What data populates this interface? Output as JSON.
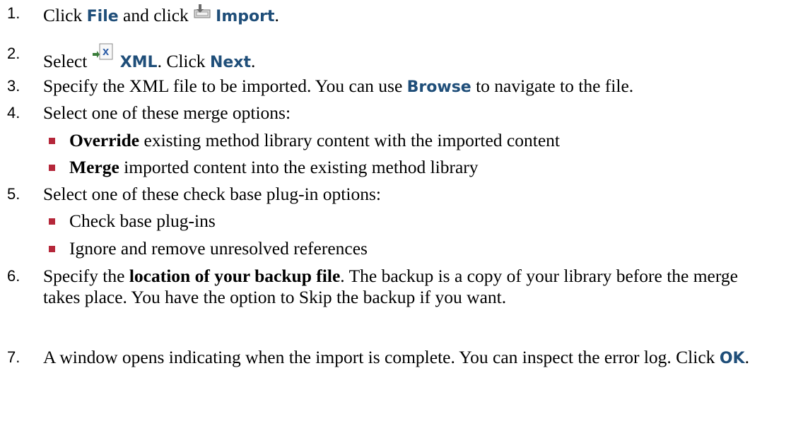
{
  "steps": [
    {
      "num": "1.",
      "t1": "Click ",
      "u1": "File",
      "t2": " and click ",
      "u2": "Import",
      "t3": ".",
      "icon": "import-icon"
    },
    {
      "num": "2.",
      "t1": "Select ",
      "u1": "XML",
      "t2": ".  Click ",
      "u2": "Next",
      "t3": ".",
      "icon": "xml-icon"
    },
    {
      "num": "3.",
      "t1": "Specify the XML file to be imported.  You can use ",
      "u1": "Browse",
      "t2": " to navigate to the file."
    },
    {
      "num": "4.",
      "t1": "Select one of these merge options:"
    },
    {
      "num": "5.",
      "t1": "Select one of these check base plug-in options:"
    },
    {
      "num": "6.",
      "t1": "Specify the ",
      "b1": "location of your backup file",
      "t2": ".  The backup is a copy of your library before the merge takes place.  You have the option to Skip the backup if you want."
    },
    {
      "num": "7.",
      "t1": "A window opens indicating when the import is complete.  You can inspect the error log.  Click ",
      "u1": "OK",
      "t2": "."
    }
  ],
  "merge_options": [
    {
      "b": "Override",
      "t": " existing method library content with the imported content"
    },
    {
      "b": "Merge",
      "t": " imported content into the existing method library"
    }
  ],
  "plugin_options": [
    {
      "t": "Check base plug-ins"
    },
    {
      "t": "Ignore and remove unresolved references"
    }
  ],
  "colors": {
    "ui_label": "#1f4e79",
    "bullet": "#b5273a"
  }
}
